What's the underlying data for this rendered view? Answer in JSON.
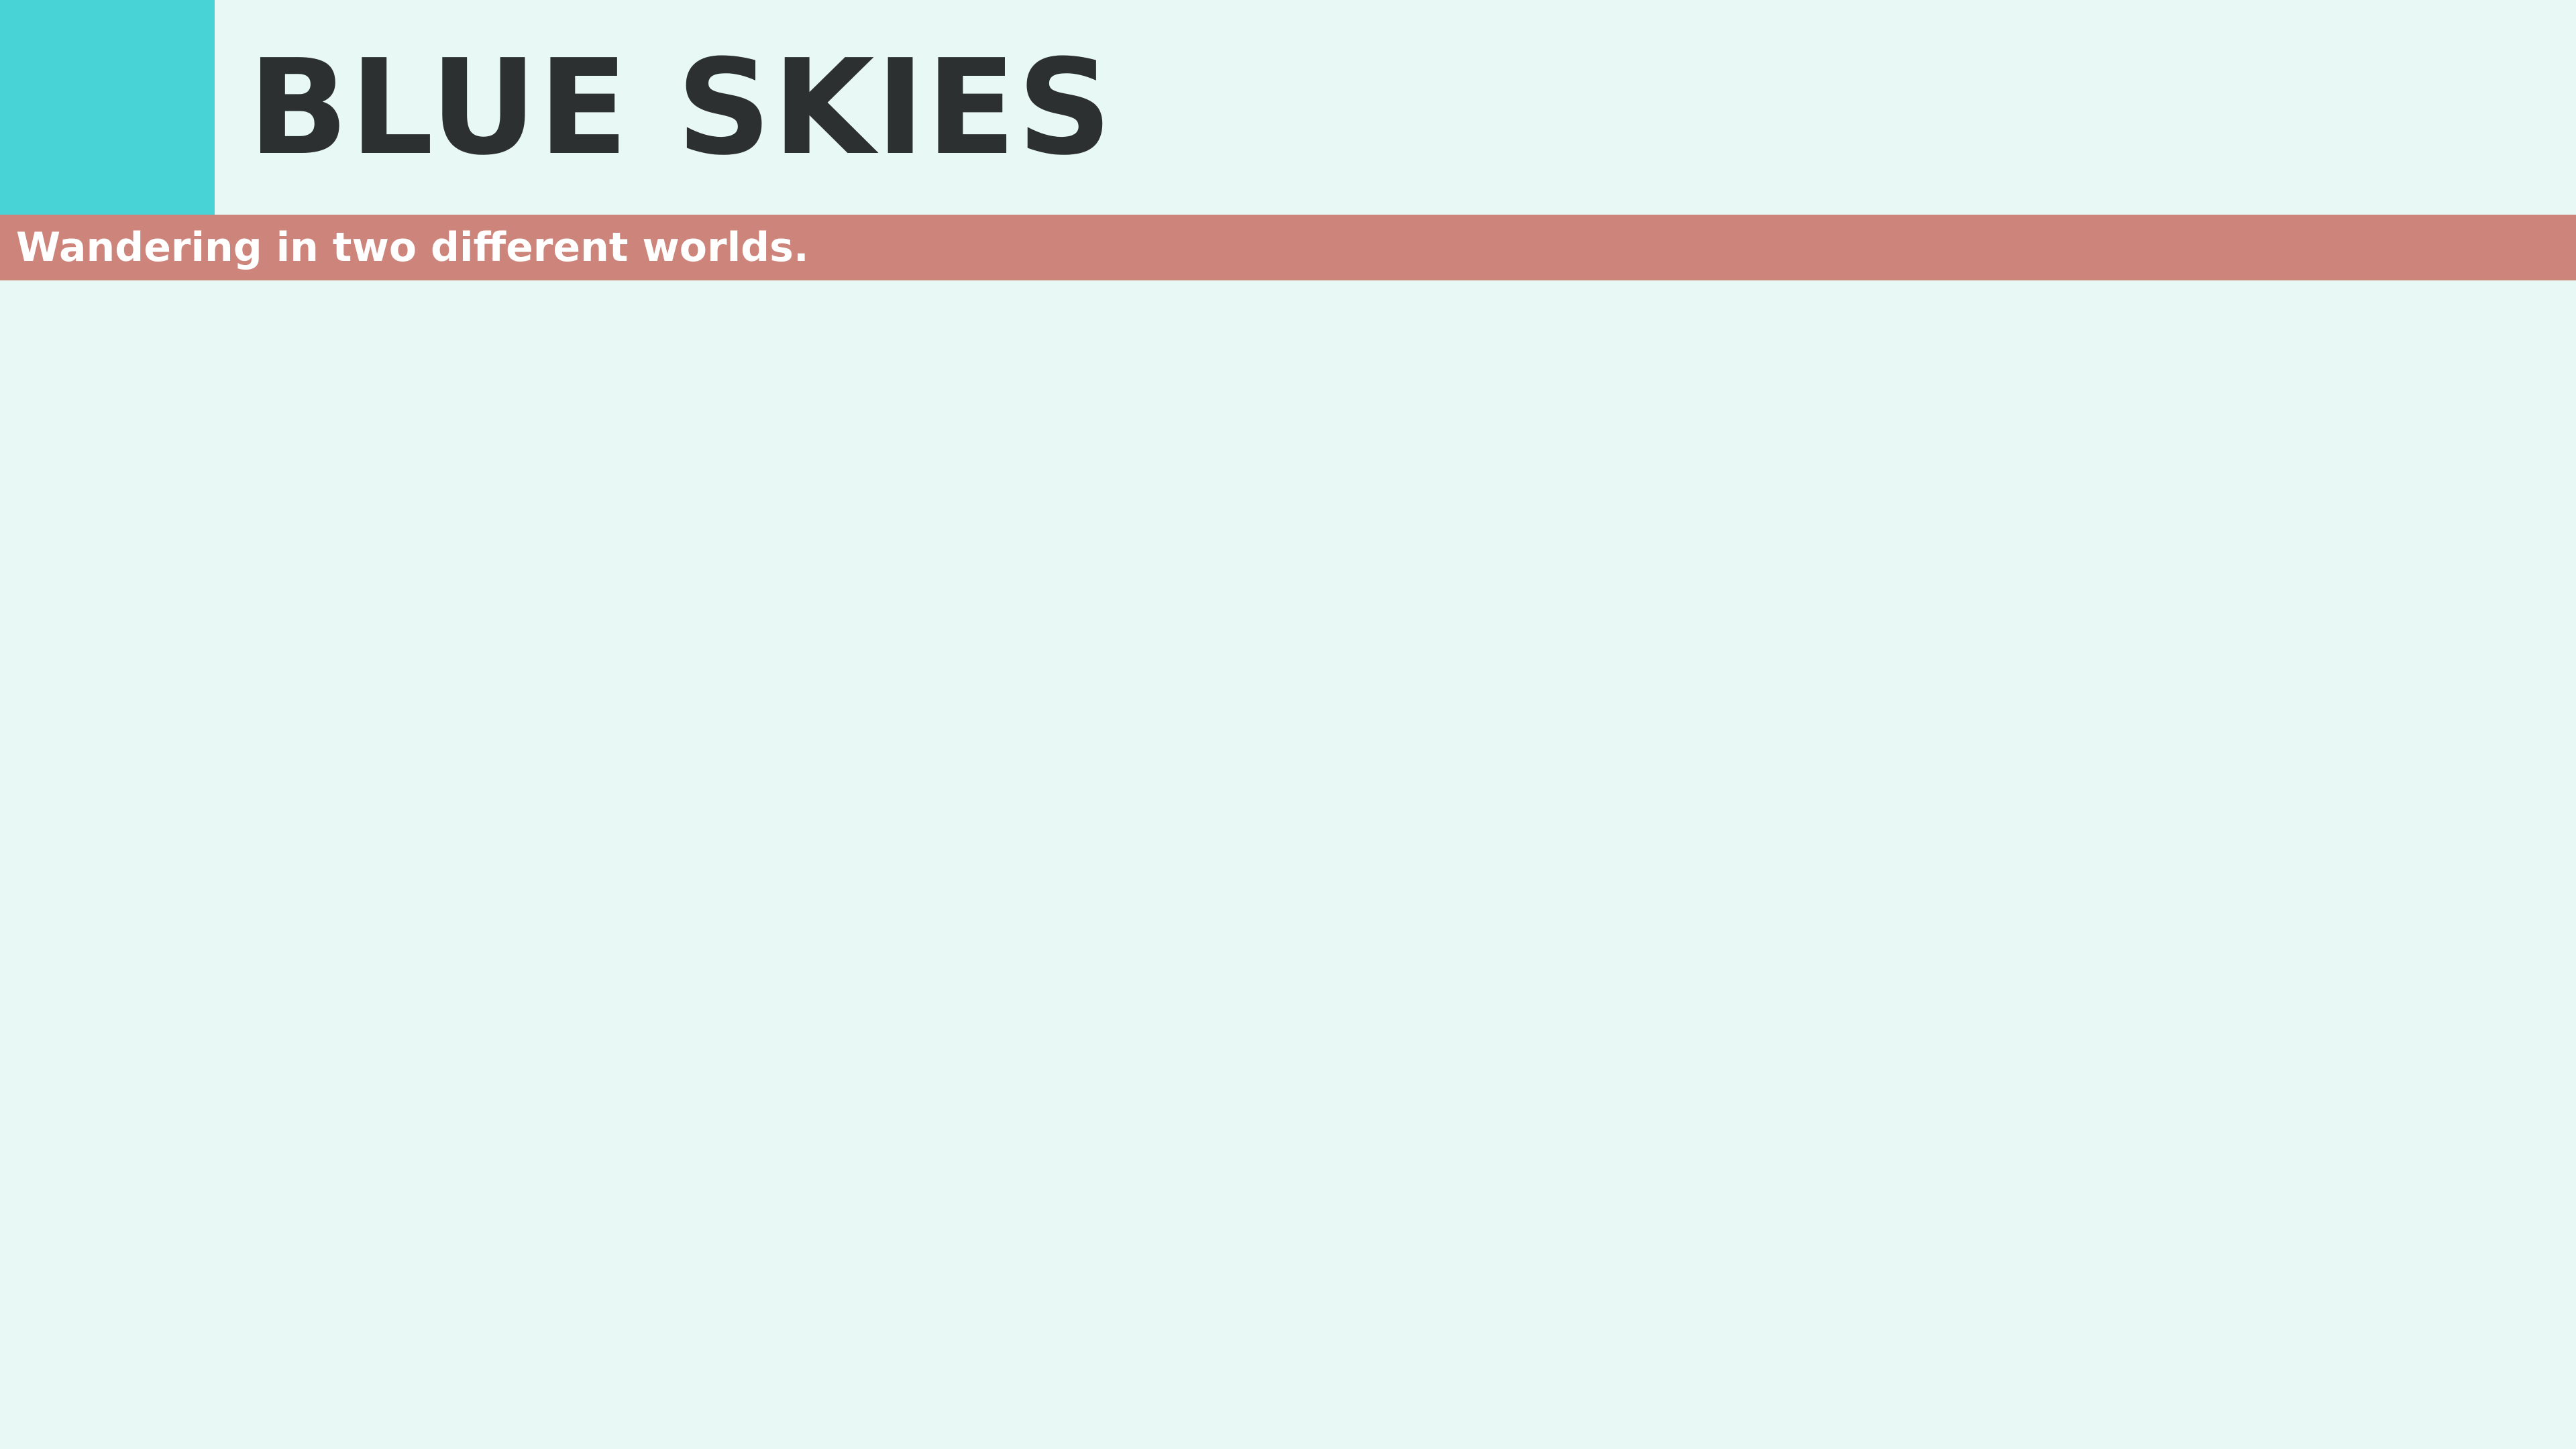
{
  "header": {
    "title": "BLUE SKIES"
  },
  "banner": {
    "subtitle": "Wandering in two different worlds."
  },
  "colors": {
    "background": "#e8f8f4",
    "accent_square": "#48d3d6",
    "banner": "#cd847b",
    "title_text": "#2d3031",
    "subtitle_text": "#ffffff"
  }
}
